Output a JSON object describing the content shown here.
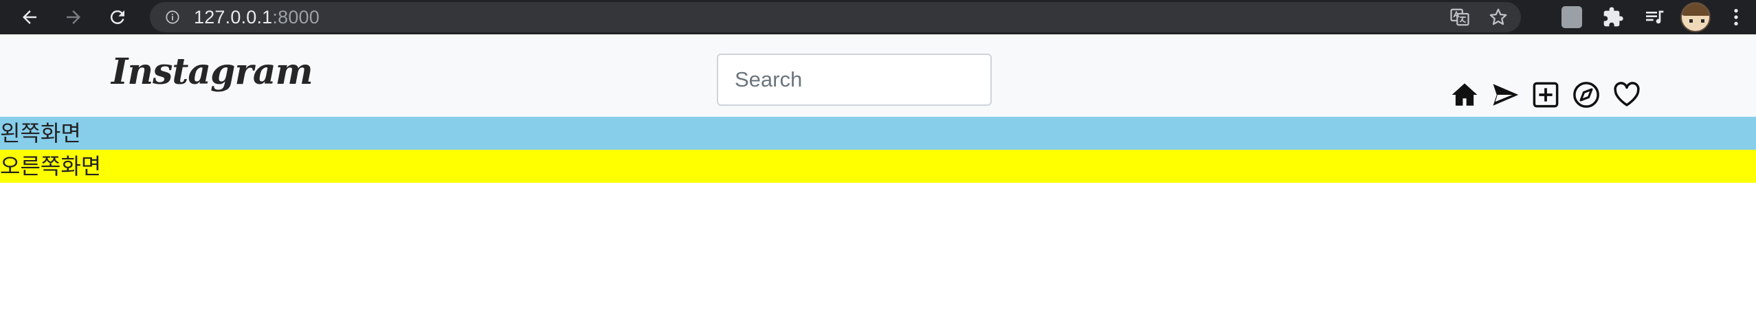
{
  "browser": {
    "url_host": "127.0.0.1",
    "url_port": ":8000"
  },
  "navbar": {
    "brand": "Instagram",
    "search": {
      "placeholder": "Search",
      "value": ""
    }
  },
  "sections": {
    "left_label": "왼쪽화면",
    "right_label": "오른쪽화면"
  },
  "colors": {
    "left_bg": "#87ceeb",
    "right_bg": "#ffff00",
    "navbar_bg": "#f8f9fa"
  }
}
